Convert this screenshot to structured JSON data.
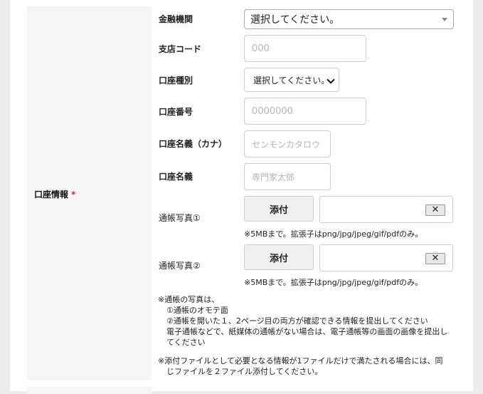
{
  "section": {
    "label": "口座情報",
    "required_mark": "*"
  },
  "fields": {
    "bank": {
      "label": "金融機関",
      "value": "選択してください。"
    },
    "branch_code": {
      "label": "支店コード",
      "placeholder": "000"
    },
    "account_type": {
      "label": "口座種別",
      "value": "選択してください。"
    },
    "account_number": {
      "label": "口座番号",
      "placeholder": "0000000"
    },
    "account_name_kana": {
      "label": "口座名義（カナ）",
      "placeholder": "センモンカタロウ"
    },
    "account_name": {
      "label": "口座名義",
      "placeholder": "専門家太郎"
    },
    "passbook_photo_1": {
      "label": "通帳写真①",
      "button": "添付",
      "clear": "✕",
      "note": "※5MBまで。拡張子はpng/jpg/jpeg/gif/pdfのみ。"
    },
    "passbook_photo_2": {
      "label": "通帳写真②",
      "button": "添付",
      "clear": "✕",
      "note": "※5MBまで。拡張子はpng/jpg/jpeg/gif/pdfのみ。"
    }
  },
  "notes": {
    "line1": "※通帳の写真は、",
    "line2": "①通帳のオモテ面",
    "line3": "②通帳を開いた１、2ページ目の両方が確認できる情報を提出してください",
    "line4": "電子通帳などで、紙媒体の通帳がない場合は、電子通帳等の画面の画像を提出し",
    "line5": "てください",
    "line6": "※添付ファイルとして必要となる情報が1ファイルだけで満たされる場合には、同",
    "line7": "じファイルを２ファイル添付してください。"
  }
}
